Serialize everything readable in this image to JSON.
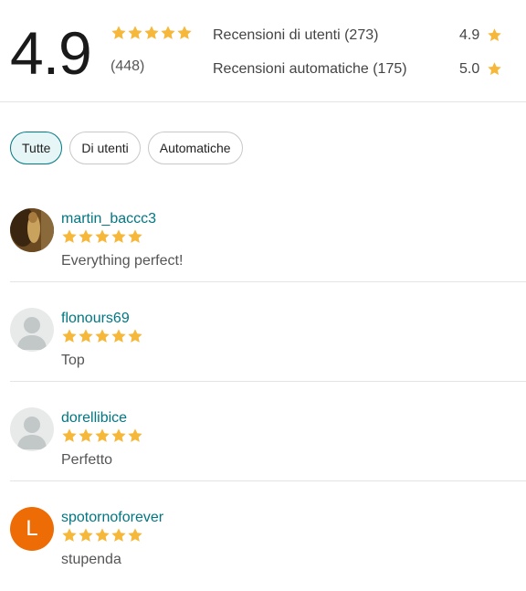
{
  "summary": {
    "score": "4.9",
    "count": "(448)",
    "rating": 5,
    "breakdown": [
      {
        "label": "Recensioni di utenti (273)",
        "value": "4.9"
      },
      {
        "label": "Recensioni automatiche (175)",
        "value": "5.0"
      }
    ]
  },
  "filters": [
    {
      "label": "Tutte",
      "active": true
    },
    {
      "label": "Di utenti",
      "active": false
    },
    {
      "label": "Automatiche",
      "active": false
    }
  ],
  "reviews": [
    {
      "username": "martin_baccc3",
      "rating": 5,
      "comment": "Everything perfect!",
      "avatar": "photo"
    },
    {
      "username": "flonours69",
      "rating": 5,
      "comment": "Top",
      "avatar": "default"
    },
    {
      "username": "dorellibice",
      "rating": 5,
      "comment": "Perfetto",
      "avatar": "default"
    },
    {
      "username": "spotornoforever",
      "rating": 5,
      "comment": "stupenda",
      "avatar": "letter",
      "initial": "L"
    }
  ],
  "colors": {
    "accent": "#007782",
    "star": "#f5b83b",
    "avatar_letter_bg": "#ee6c05"
  }
}
